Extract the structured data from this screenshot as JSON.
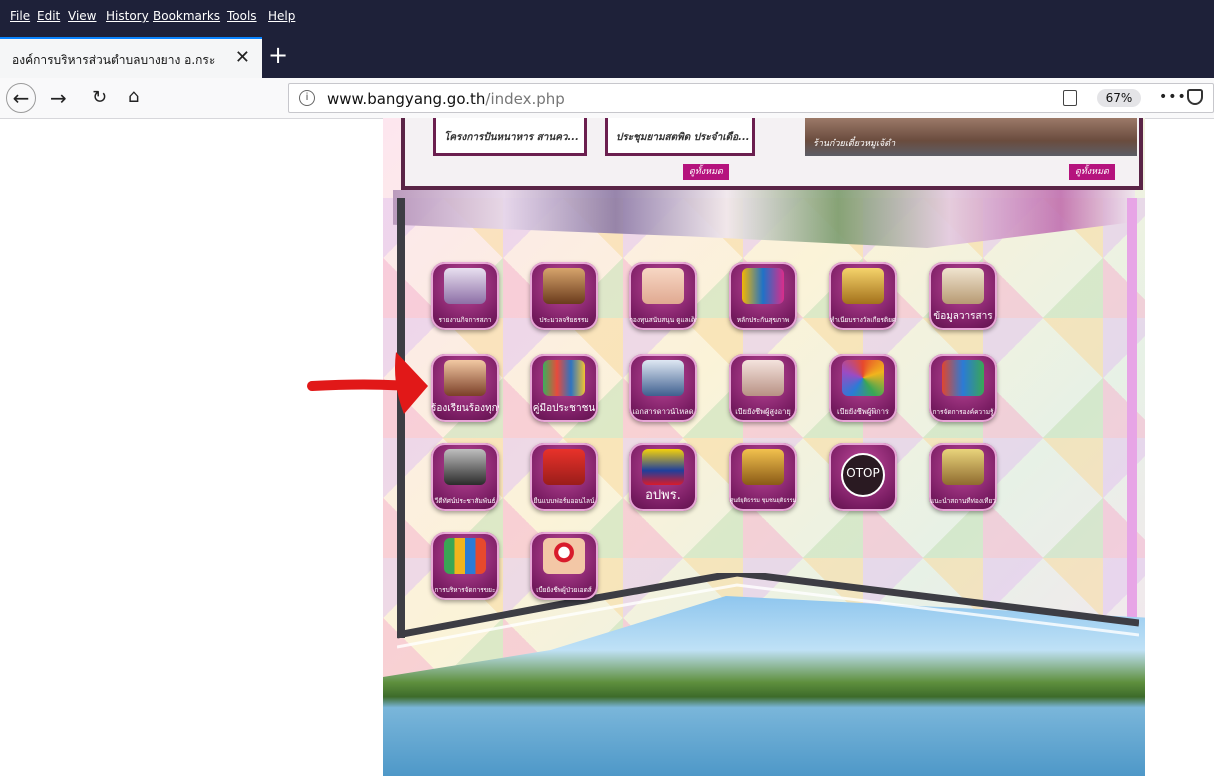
{
  "browser": {
    "menu": [
      "File",
      "Edit",
      "View",
      "History",
      "Bookmarks",
      "Tools",
      "Help"
    ],
    "tab_title": "องค์การบริหารส่วนตำบลบางยาง อ.กระ",
    "new_tab": "+",
    "url": {
      "host": "www.bangyang.go.th",
      "path": "/index.php"
    },
    "zoom": "67%",
    "more": "•••",
    "colors": {
      "chrome_dark": "#1e2139",
      "accent": "#0a84ff"
    }
  },
  "site": {
    "news_cards": [
      "โครงการปันหนาหาร สานคว...",
      "ประชุมยามสตพิด ประจำเดือ..."
    ],
    "photo_caption": "ร้านก๋วยเตี๋ยวหมูเจ้ดำ",
    "see_all": "ดูทั้งหมด",
    "colors": {
      "tile": "#7a1d63",
      "frame": "#5a2446",
      "button": "#b5137d",
      "annotation_arrow": "#e11818"
    },
    "tiles": [
      {
        "label": "รายงานกิจการสภา",
        "icon": "folder-icon"
      },
      {
        "label": "ประมวลจริยธรรม",
        "icon": "gavel-icon"
      },
      {
        "label": "กองทุนสนับสนุน ดูแลเด็กแรกเกิด",
        "icon": "baby-icon"
      },
      {
        "label": "หลักประกันสุขภาพ",
        "icon": "health-icon"
      },
      {
        "label": "ทำเนียบรางวัลเกียรติยศ",
        "icon": "trophy-icon"
      },
      {
        "label": "ข้อมูลวารสาร",
        "icon": "journal-icon"
      },
      {
        "label": "ร้องเรียนร้องทุกข์",
        "icon": "megaphone-icon"
      },
      {
        "label": "คู่มือประชาชน",
        "icon": "books-icon"
      },
      {
        "label": "เอกสารดาวน์โหลด",
        "icon": "download-icon"
      },
      {
        "label": "เบี้ยยังชีพผู้สูงอายุ",
        "icon": "elderly-icon"
      },
      {
        "label": "เบี้ยยังชีพผู้พิการ",
        "icon": "disability-icon"
      },
      {
        "label": "การจัดการองค์ความรู้",
        "icon": "knowledge-icon"
      },
      {
        "label": "วีดีทัศน์ประชาสัมพันธ์",
        "icon": "film-icon"
      },
      {
        "label": "ยื่นแบบฟอร์มออนไลน์",
        "icon": "online-icon"
      },
      {
        "label": "อปพร.",
        "icon": "badge-icon"
      },
      {
        "label": "ศูนย์ยุติธรรม ชุมชนยุติธรรม",
        "icon": "scales-icon"
      },
      {
        "label": "OTOP",
        "icon": "otop-icon"
      },
      {
        "label": "แนะนำสถานที่ท่องเที่ยว",
        "icon": "temple-icon"
      },
      {
        "label": "การบริหารจัดการขยะ",
        "icon": "recycle-bin-icon"
      },
      {
        "label": "เบี้ยยังชีพผู้ป่วยเอดส์",
        "icon": "ribbon-icon"
      }
    ]
  }
}
